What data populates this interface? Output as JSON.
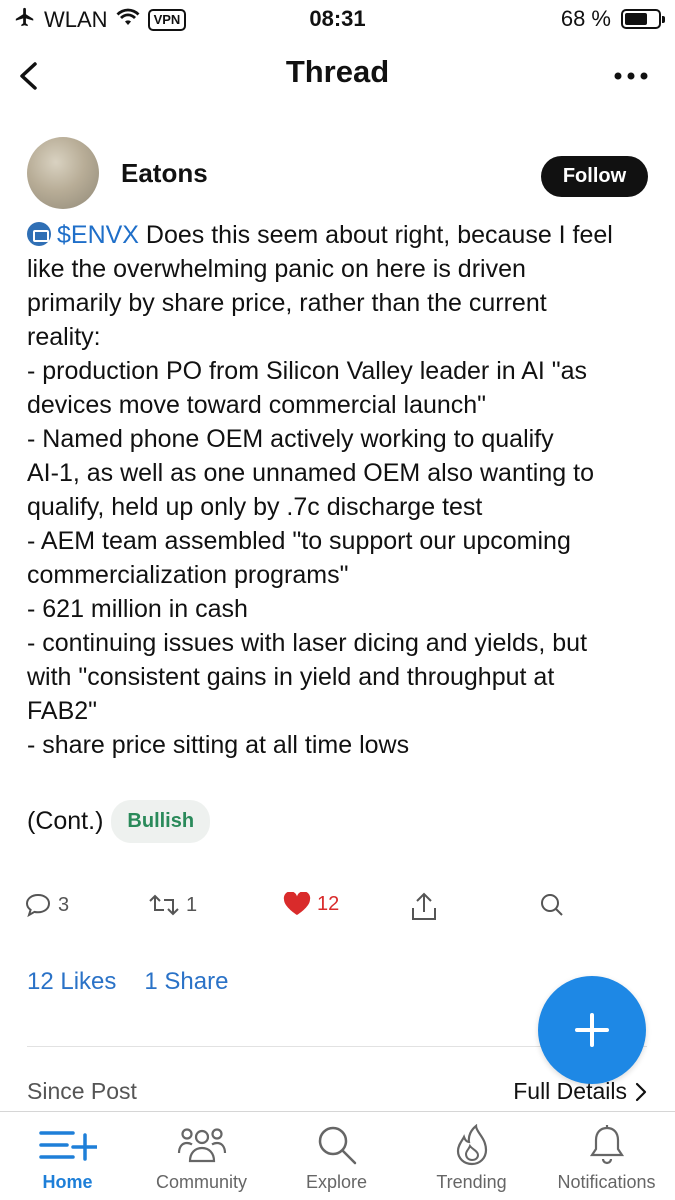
{
  "status_bar": {
    "network": "WLAN",
    "vpn": "VPN",
    "time": "08:31",
    "battery": "68 %",
    "battery_level": 0.68
  },
  "nav": {
    "title": "Thread",
    "back_icon": "chevron-left-icon",
    "more_icon": "ellipsis-icon"
  },
  "post": {
    "author": "Eatons",
    "follow_label": "Follow",
    "ticker": "$ENVX",
    "lines": [
      " Does this seem about right, because I feel",
      "like the overwhelming panic on here is driven",
      "primarily by share price, rather than the current",
      "reality:",
      "- production PO from Silicon Valley leader in AI \"as",
      "devices move toward commercial launch\"",
      "- Named phone OEM actively working to qualify",
      "AI-1, as well as one unnamed OEM also wanting to",
      "qualify, held up only by .7c discharge test",
      "- AEM team assembled \"to support our upcoming",
      "commercialization programs\"",
      "- 621 million in cash",
      "- continuing issues with laser dicing and yields, but",
      "with \"consistent gains in yield and throughput at",
      "FAB2\"",
      "- share price sitting at all time lows"
    ],
    "cont": "(Cont.)",
    "sentiment": "Bullish"
  },
  "actions": {
    "comments": "3",
    "reshares": "1",
    "likes": "12"
  },
  "stats": {
    "likes_text": "12 Likes",
    "shares_text": "1 Share"
  },
  "since_post": {
    "label": "Since Post",
    "details_label": "Full Details"
  },
  "colors": {
    "accent": "#1e88e5",
    "like": "#d92b2b",
    "bullish": "#2a8a5a",
    "link": "#2a72c7"
  },
  "tabs": [
    {
      "label": "Home",
      "icon": "home-feed-icon",
      "active": true
    },
    {
      "label": "Community",
      "icon": "community-icon",
      "active": false
    },
    {
      "label": "Explore",
      "icon": "search-icon",
      "active": false
    },
    {
      "label": "Trending",
      "icon": "flame-icon",
      "active": false
    },
    {
      "label": "Notifications",
      "icon": "bell-icon",
      "active": false
    }
  ]
}
